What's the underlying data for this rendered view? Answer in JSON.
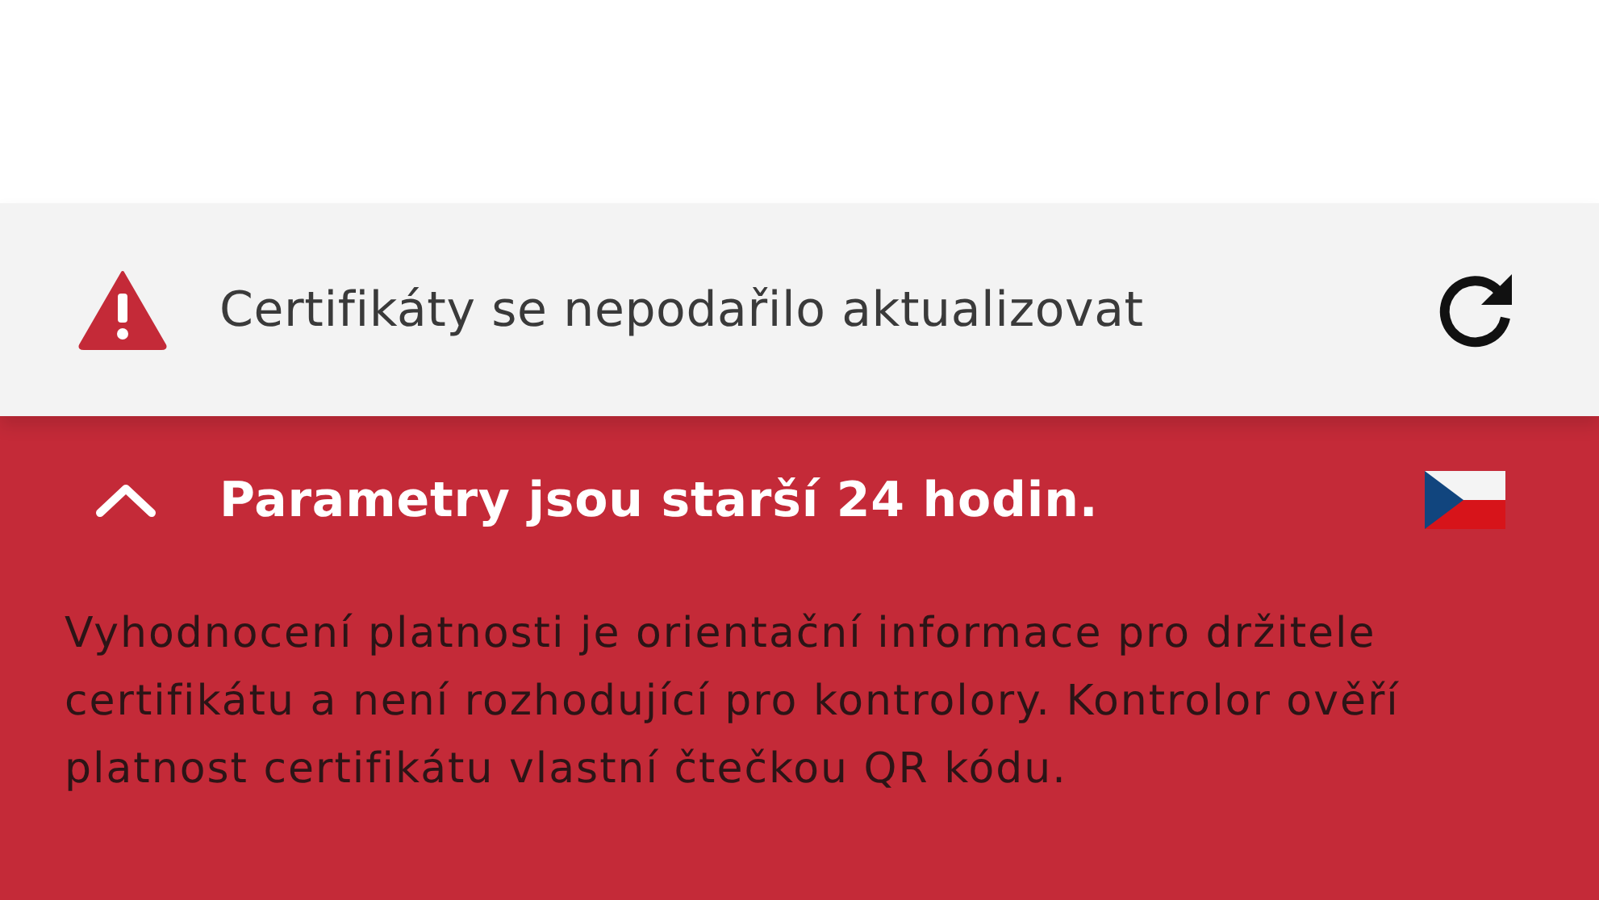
{
  "banner": {
    "message": "Certifikáty se nepodařilo aktualizovat"
  },
  "panel": {
    "expanded": true,
    "title": "Parametry jsou starší 24 hodin.",
    "body": "Vyhodnocení platnosti je orientační informace pro držitele certifikátu a není rozhodující pro kontrolory. Kontrolor ověří platnost certifikátu vlastní čtečkou QR kódu."
  }
}
